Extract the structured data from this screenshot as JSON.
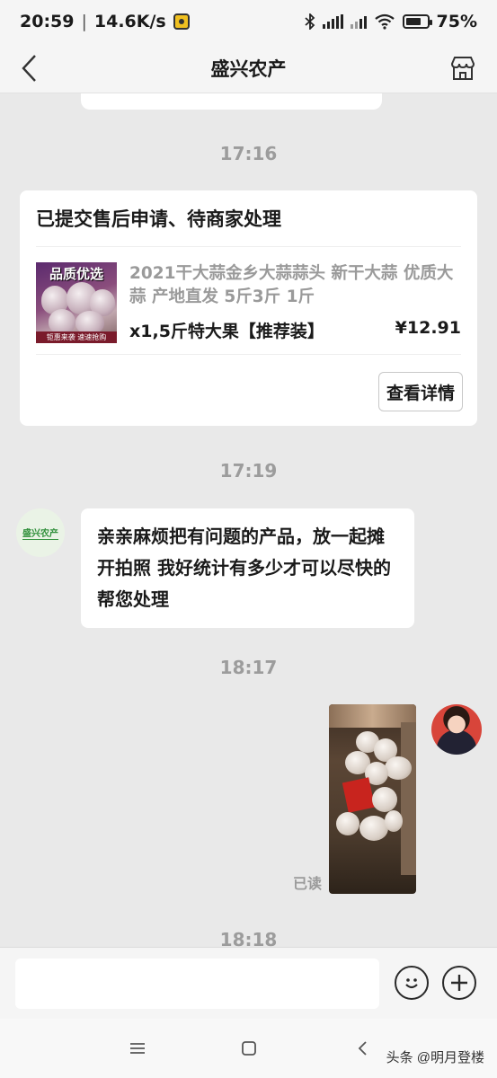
{
  "status_bar": {
    "time": "20:59",
    "speed": "14.6K/s",
    "battery": "75%",
    "battery_level": 0.75
  },
  "header": {
    "title": "盛兴农产",
    "icons": {
      "back": "back-chevron-icon",
      "store": "store-icon"
    }
  },
  "chat": {
    "messages": [
      {
        "type": "timestamp",
        "text": "17:16"
      },
      {
        "type": "order_card",
        "status": "已提交售后申请、待商家处理",
        "product": {
          "thumb_badge": "品质优选",
          "thumb_caption": "钜惠来袭 速速抢购",
          "name": "2021干大蒜金乡大蒜蒜头 新干大蒜 优质大蒜 产地直发 5斤3斤 1斤",
          "spec": "x1,5斤特大果【推荐装】",
          "price": "¥12.91"
        },
        "detail_button": "查看详情"
      },
      {
        "type": "timestamp",
        "text": "17:19"
      },
      {
        "type": "incoming_text",
        "sender_logo": "盛兴农产",
        "text": "亲亲麻烦把有问题的产品，放一起摊开拍照 我好统计有多少才可以尽快的帮您处理"
      },
      {
        "type": "timestamp",
        "text": "18:17"
      },
      {
        "type": "outgoing_image",
        "read_label": "已读"
      },
      {
        "type": "timestamp",
        "text": "18:18"
      }
    ]
  },
  "input_bar": {
    "icons": {
      "emoji": "emoji-icon",
      "add": "plus-icon"
    }
  },
  "system_nav": {
    "icons": {
      "menu": "menu-icon",
      "home": "home-square-icon",
      "back": "back-arrow-icon"
    }
  },
  "watermark": "头条 @明月登楼"
}
